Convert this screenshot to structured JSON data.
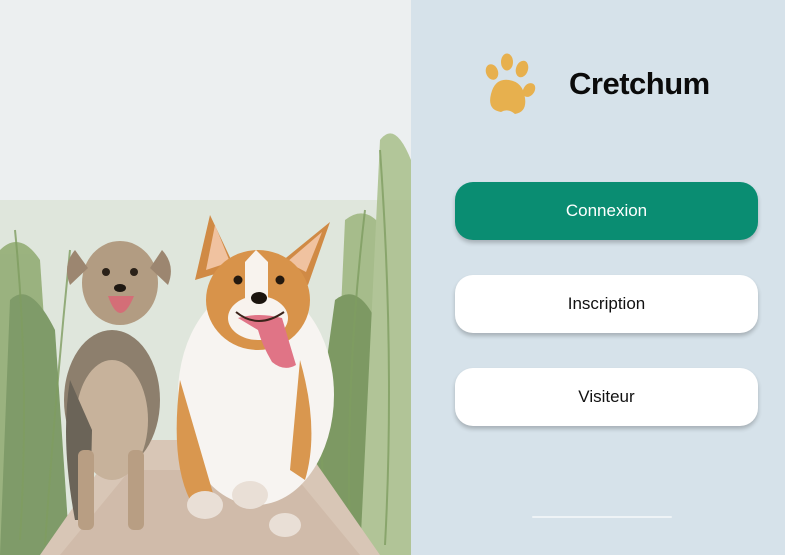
{
  "app": {
    "name": "Cretchum",
    "logo_icon": "paw-icon",
    "logo_color": "#e7b04e"
  },
  "photo": {
    "subject": "dogs-running-photo"
  },
  "actions": {
    "connexion_label": "Connexion",
    "inscription_label": "Inscription",
    "visiteur_label": "Visiteur"
  },
  "colors": {
    "primary": "#0a8d72",
    "panel_background": "#d6e2ea",
    "secondary_button": "#ffffff"
  }
}
